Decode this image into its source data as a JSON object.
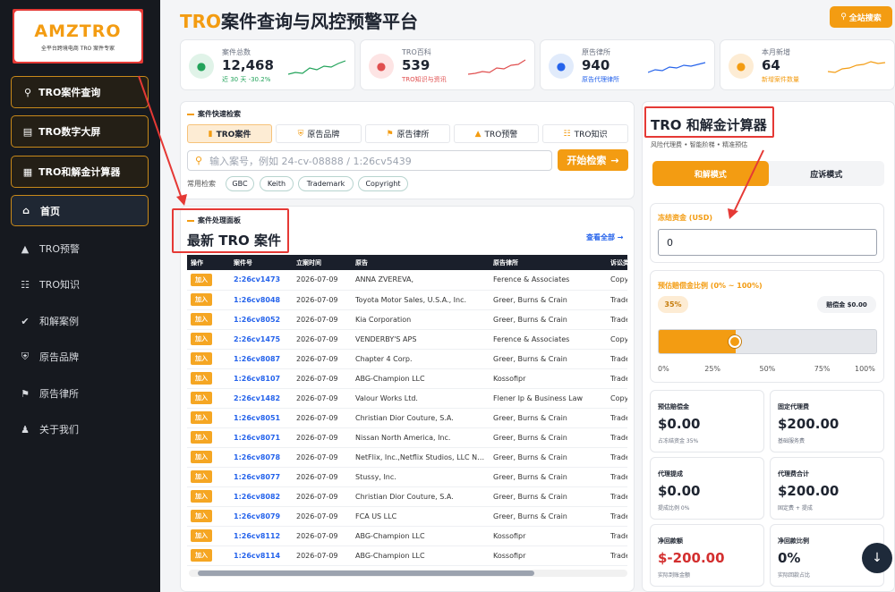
{
  "logo": {
    "name": "AMZTRO",
    "tagline": "全平台跨境电商 TRO 案件专家"
  },
  "sidebar": {
    "feature_buttons": [
      {
        "label": "TRO案件查询",
        "icon": "search-icon"
      },
      {
        "label": "TRO数字大屏",
        "icon": "chart-icon"
      },
      {
        "label": "TRO和解金计算器",
        "icon": "calculator-icon"
      }
    ],
    "home": {
      "label": "首页",
      "icon": "home-icon"
    },
    "items": [
      {
        "label": "TRO预警",
        "icon": "bell-icon"
      },
      {
        "label": "TRO知识",
        "icon": "book-icon"
      },
      {
        "label": "和解案例",
        "icon": "check-circle-icon"
      },
      {
        "label": "原告品牌",
        "icon": "shield-icon"
      },
      {
        "label": "原告律所",
        "icon": "bank-icon"
      },
      {
        "label": "关于我们",
        "icon": "users-icon"
      }
    ]
  },
  "header": {
    "title_tro": "TRO",
    "title_rest": "案件查询与风控预警平台",
    "search_all": "全站搜索"
  },
  "stats": [
    {
      "label": "案件总数",
      "value": "12,468",
      "sub": "近 30 天 -30.2%",
      "color": "#22a35a",
      "bg": "#e0f3e8",
      "icon": "folder-icon"
    },
    {
      "label": "TRO百科",
      "value": "539",
      "sub": "TRO知识与资讯",
      "color": "#e04f4f",
      "bg": "#fde4e4",
      "icon": "book-icon"
    },
    {
      "label": "原告律所",
      "value": "940",
      "sub": "原告代理律所",
      "color": "#2563eb",
      "bg": "#e1ebfb",
      "icon": "scale-icon"
    },
    {
      "label": "本月新增",
      "value": "64",
      "sub": "新增案件数量",
      "color": "#f39c12",
      "bg": "#fdecd4",
      "icon": "arrow-up-icon"
    }
  ],
  "quick_search": {
    "section_label": "案件快速检索",
    "tabs": [
      "TRO案件",
      "原告品牌",
      "原告律所",
      "TRO预警",
      "TRO知识"
    ],
    "placeholder": "输入案号，例如 24-cv-08888 / 1:26cv5439",
    "button": "开始检索",
    "common_label": "常用检索",
    "chips": [
      "GBC",
      "Keith",
      "Trademark",
      "Copyright"
    ]
  },
  "cases": {
    "section_label": "案件处理面板",
    "title": "最新 TRO 案件",
    "view_all": "查看全部",
    "columns": [
      "操作",
      "案件号",
      "立案时间",
      "原告",
      "原告律所",
      "诉讼类"
    ],
    "add_label": "加入",
    "rows": [
      [
        "2:26cv1473",
        "2026-07-09",
        "ANNA ZVEREVA,",
        "Ference & Associates",
        "Copy"
      ],
      [
        "1:26cv8048",
        "2026-07-09",
        "Toyota Motor Sales, U.S.A., Inc.",
        "Greer, Burns & Crain",
        "Trade"
      ],
      [
        "1:26cv8052",
        "2026-07-09",
        "Kia Corporation",
        "Greer, Burns & Crain",
        "Trade"
      ],
      [
        "2:26cv1475",
        "2026-07-09",
        "VENDERBY'S APS",
        "Ference & Associates",
        "Copy"
      ],
      [
        "1:26cv8087",
        "2026-07-09",
        "Chapter 4 Corp.",
        "Greer, Burns & Crain",
        "Trade"
      ],
      [
        "1:26cv8107",
        "2026-07-09",
        "ABG-Champion LLC",
        "Kossofipr",
        "Trade"
      ],
      [
        "2:26cv1482",
        "2026-07-09",
        "Valour Works Ltd.",
        "Flener Ip & Business Law",
        "Copy"
      ],
      [
        "1:26cv8051",
        "2026-07-09",
        "Christian Dior Couture, S.A.",
        "Greer, Burns & Crain",
        "Trade"
      ],
      [
        "1:26cv8071",
        "2026-07-09",
        "Nissan North America, Inc.",
        "Greer, Burns & Crain",
        "Trade"
      ],
      [
        "1:26cv8078",
        "2026-07-09",
        "NetFlix, Inc.,Netflix Studios, LLC N…",
        "Greer, Burns & Crain",
        "Trade"
      ],
      [
        "1:26cv8077",
        "2026-07-09",
        "Stussy, Inc.",
        "Greer, Burns & Crain",
        "Trade"
      ],
      [
        "1:26cv8082",
        "2026-07-09",
        "Christian Dior Couture, S.A.",
        "Greer, Burns & Crain",
        "Trade"
      ],
      [
        "1:26cv8079",
        "2026-07-09",
        "FCA US LLC",
        "Greer, Burns & Crain",
        "Trade"
      ],
      [
        "1:26cv8112",
        "2026-07-09",
        "ABG-Champion LLC",
        "Kossofipr",
        "Trade"
      ],
      [
        "1:26cv8114",
        "2026-07-09",
        "ABG-Champion LLC",
        "Kossofipr",
        "Trade"
      ]
    ]
  },
  "calculator": {
    "title": "TRO 和解金计算器",
    "subtitle": "风险代理费 • 智能阶梯 • 精准预估",
    "modes": [
      "和解模式",
      "应诉模式"
    ],
    "frozen_label": "冻结资金 (USD)",
    "frozen_value": "0",
    "ratio_label": "预估赔偿金比例 (0% ~ 100%)",
    "ratio_value": "35%",
    "ratio_fraction": 0.35,
    "comp_badge": "赔偿金 $0.00",
    "scale": [
      "0%",
      "25%",
      "50%",
      "75%",
      "100%"
    ],
    "cards": [
      {
        "k": "预估赔偿金",
        "v": "$0.00",
        "s": "占冻结资金 35%",
        "vcolor": "#1e2430"
      },
      {
        "k": "固定代理费",
        "v": "$200.00",
        "s": "基础服务费",
        "vcolor": "#1e2430"
      },
      {
        "k": "代理提成",
        "v": "$0.00",
        "s": "提成比例 0%",
        "vcolor": "#1e2430"
      },
      {
        "k": "代理费合计",
        "v": "$200.00",
        "s": "固定费 + 提成",
        "vcolor": "#1e2430"
      },
      {
        "k": "净回款额",
        "v": "$-200.00",
        "s": "实际到账金额",
        "vcolor": "#d32f2f"
      },
      {
        "k": "净回款比例",
        "v": "0%",
        "s": "实际回款占比",
        "vcolor": "#1e2430"
      }
    ]
  },
  "colors": {
    "accent": "#f39c12",
    "annotation": "#e53935",
    "sidebar_bg": "#16191f"
  }
}
